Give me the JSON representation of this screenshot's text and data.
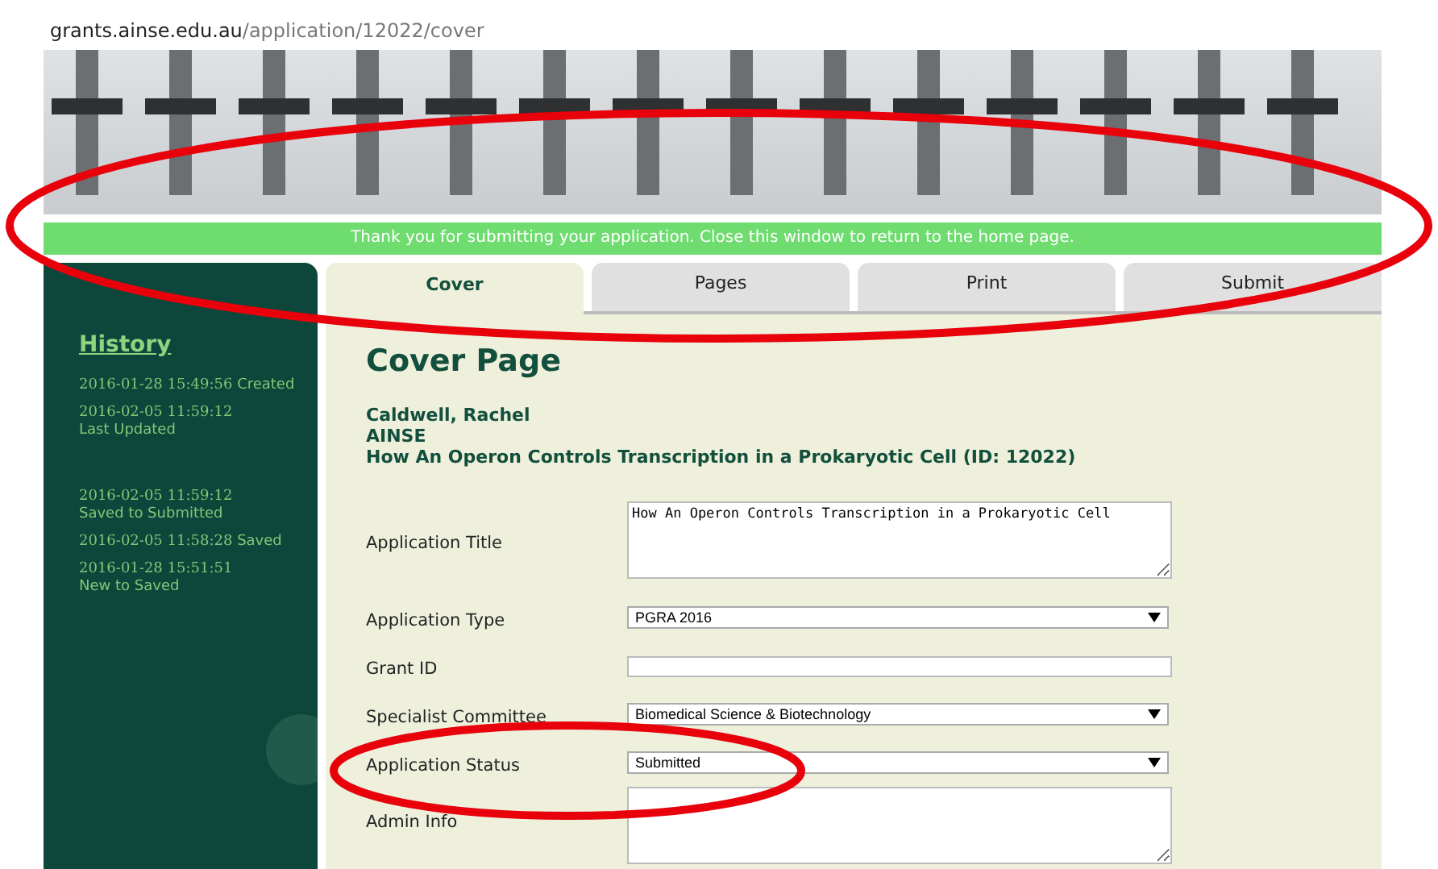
{
  "address_bar": {
    "domain": "grants.ainse.edu.au",
    "path": "/application/12022/cover"
  },
  "notice": "Thank you for submitting your application. Close this window to return to the home page.",
  "sidebar": {
    "heading": "History",
    "entries": [
      {
        "time": "2016-01-28 15:49:56",
        "label": "Created"
      },
      {
        "time": "2016-02-05 11:59:12",
        "label": "Last Updated"
      },
      {
        "time": "2016-02-05 11:59:12",
        "label": "Saved to Submitted"
      },
      {
        "time": "2016-02-05 11:58:28",
        "label": "Saved"
      },
      {
        "time": "2016-01-28 15:51:51",
        "label": "New to Saved"
      }
    ]
  },
  "tabs": [
    {
      "label": "Cover",
      "selected": true
    },
    {
      "label": "Pages",
      "selected": false
    },
    {
      "label": "Print",
      "selected": false
    },
    {
      "label": "Submit",
      "selected": false
    }
  ],
  "page_title": "Cover Page",
  "applicant": [
    "Caldwell, Rachel",
    "AINSE",
    "How An Operon Controls Transcription in a Prokaryotic Cell (ID: 12022)"
  ],
  "form": [
    {
      "label": "Application Title",
      "kind": "textarea",
      "value": "How An Operon Controls Transcription in a Prokaryotic Cell"
    },
    {
      "label": "Application Type",
      "kind": "select",
      "value": "PGRA 2016"
    },
    {
      "label": "Grant ID",
      "kind": "text"
    },
    {
      "label": "Specialist Committee",
      "kind": "select",
      "value": "Biomedical Science & Biotechnology"
    },
    {
      "label": "Application Status",
      "kind": "select",
      "value": "Submitted"
    },
    {
      "label": "Admin Info",
      "kind": "textarea"
    }
  ],
  "annotations": [
    {
      "kind": "ellipse"
    },
    {
      "kind": "ellipse"
    }
  ]
}
